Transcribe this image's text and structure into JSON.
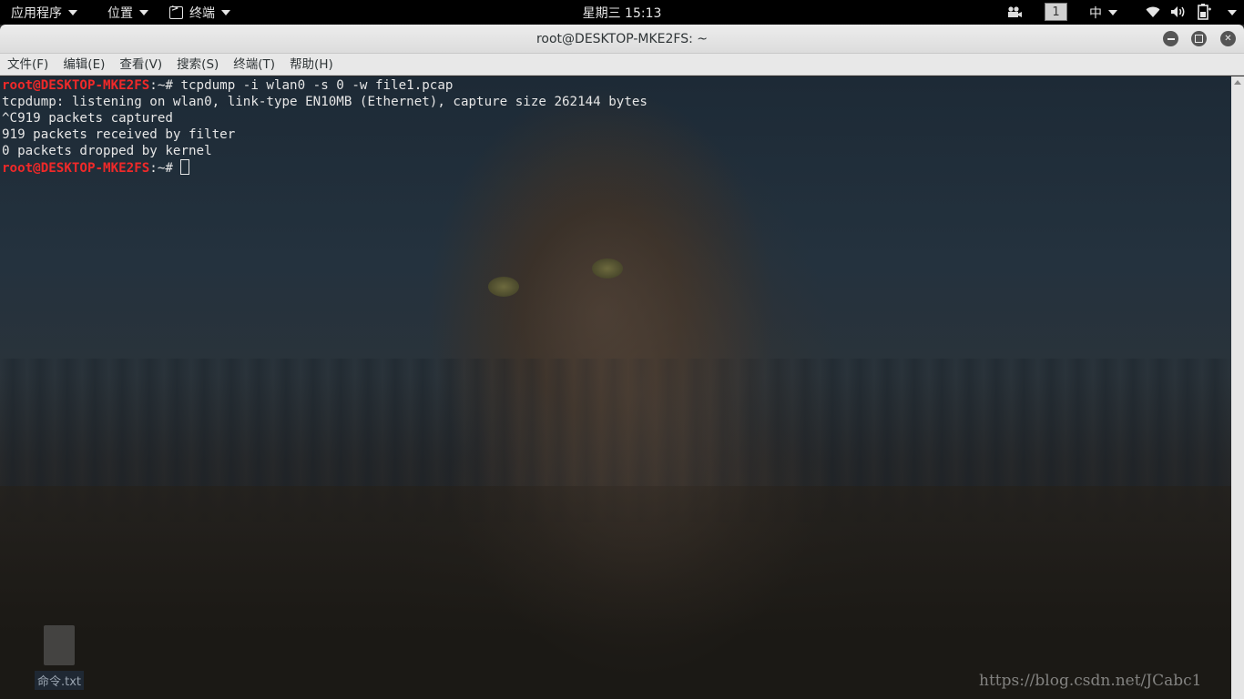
{
  "topbar": {
    "apps_label": "应用程序",
    "places_label": "位置",
    "terminal_label": "终端",
    "clock": "星期三 15:13",
    "workspace": "1",
    "ime": "中"
  },
  "window": {
    "title": "root@DESKTOP-MKE2FS: ~",
    "menu": [
      "文件(F)",
      "编辑(E)",
      "查看(V)",
      "搜索(S)",
      "终端(T)",
      "帮助(H)"
    ]
  },
  "terminal": {
    "prompt_user": "root@DESKTOP-MKE2FS",
    "prompt_path": ":~# ",
    "command": "tcpdump -i wlan0 -s 0 -w file1.pcap",
    "output": [
      "tcpdump: listening on wlan0, link-type EN10MB (Ethernet), capture size 262144 bytes",
      "^C919 packets captured",
      "919 packets received by filter",
      "0 packets dropped by kernel"
    ]
  },
  "desktop": {
    "file_label": "命令.txt",
    "watermark": "https://blog.csdn.net/JCabc1"
  }
}
